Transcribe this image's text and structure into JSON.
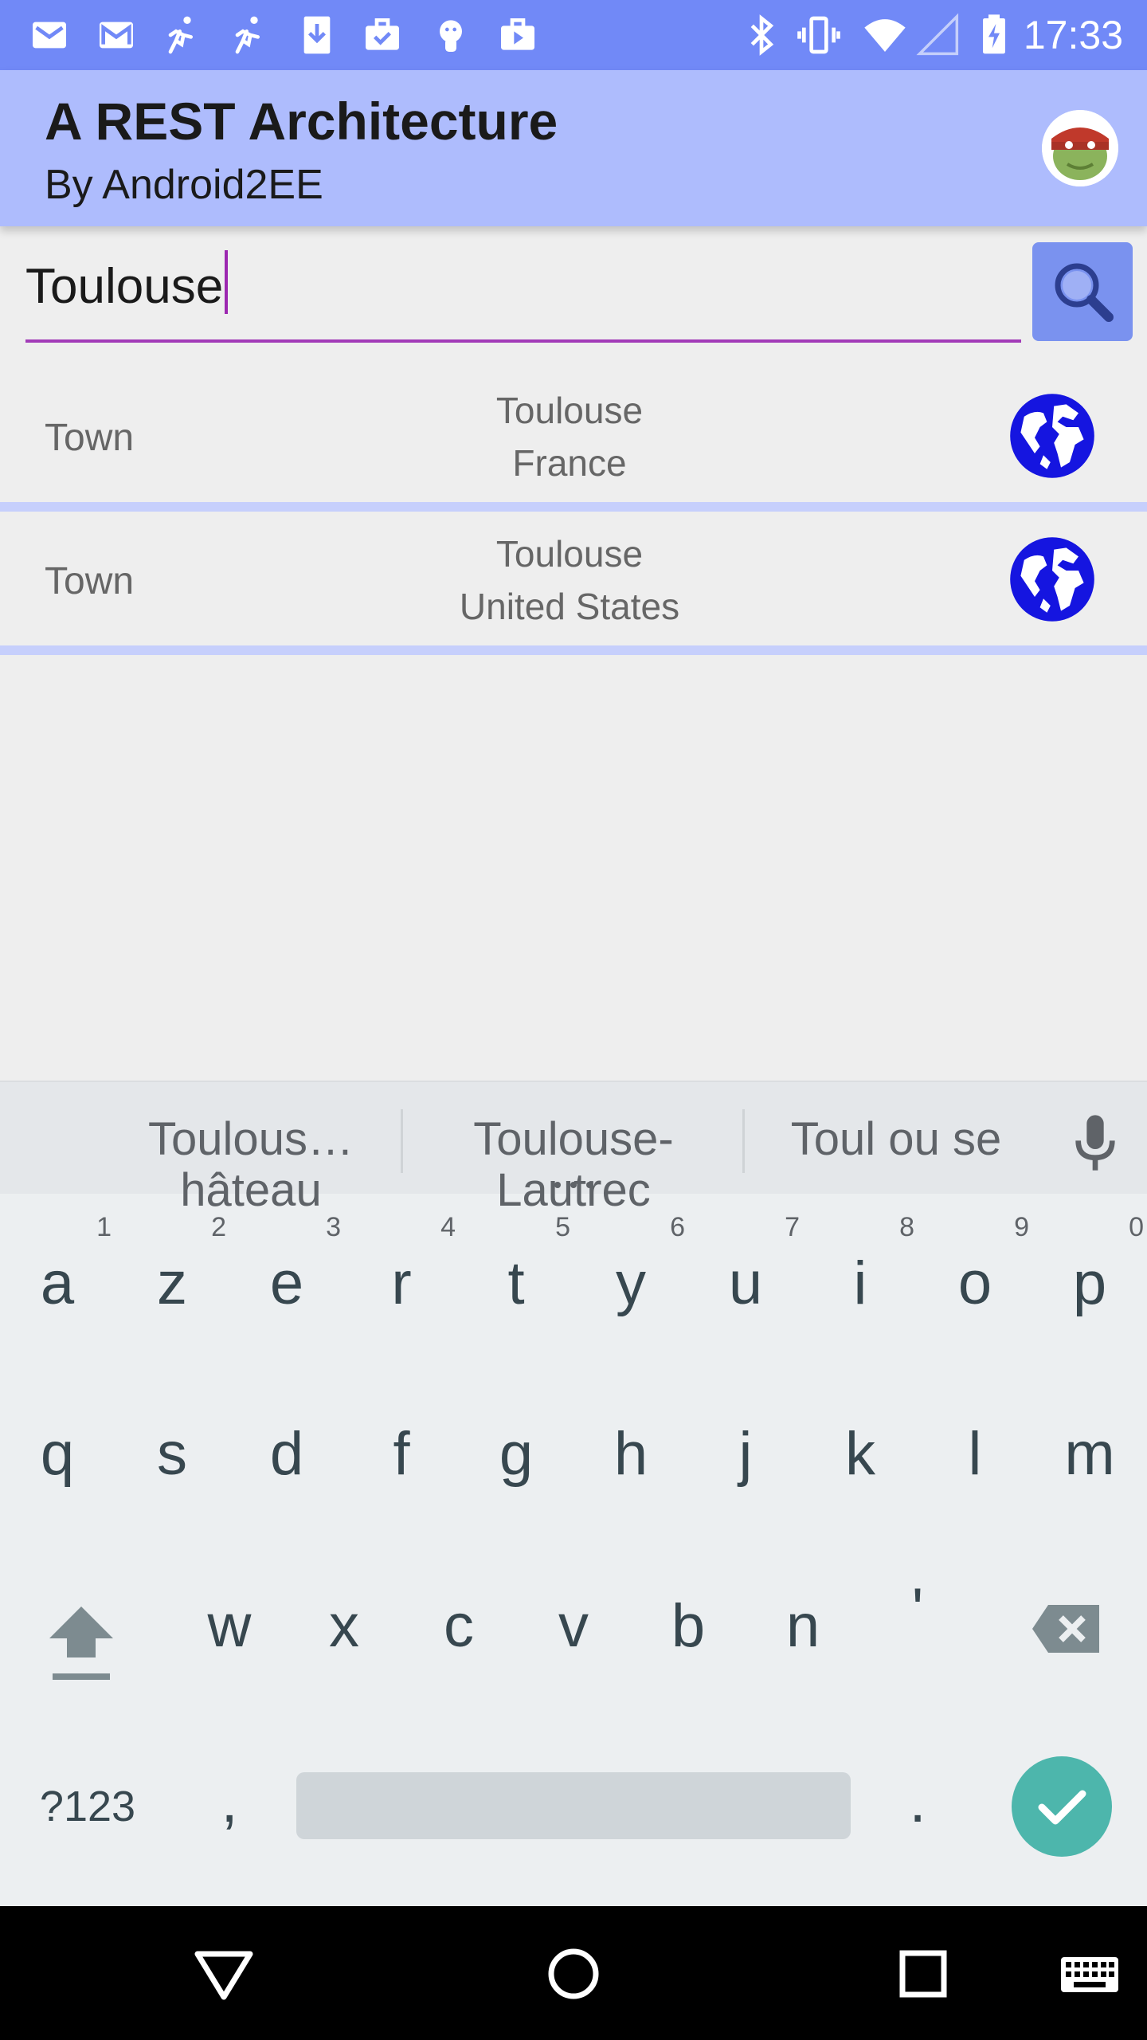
{
  "status_bar": {
    "time": "17:33",
    "notification_icons": [
      "mail-icon",
      "gmail-icon",
      "runner-icon",
      "runner-icon",
      "download-icon",
      "briefcase-check-icon",
      "android-icon",
      "briefcase-play-icon"
    ],
    "system_icons": [
      "bluetooth-icon",
      "vibrate-icon",
      "wifi-icon",
      "cell-signal-icon",
      "battery-charging-icon"
    ]
  },
  "app_bar": {
    "title": "A REST Architecture",
    "subtitle": "By Android2EE",
    "avatar_icon": "android-avatar-icon",
    "background": "#aebcfd"
  },
  "search": {
    "value": "Toulouse",
    "button_icon": "search-icon",
    "accent": "#9c27b0"
  },
  "results": [
    {
      "kind": "Town",
      "city": "Toulouse",
      "country": "France",
      "icon": "globe-icon"
    },
    {
      "kind": "Town",
      "city": "Toulouse",
      "country": "United States",
      "icon": "globe-icon"
    }
  ],
  "keyboard": {
    "suggestions": [
      "Toulous…hâteau",
      "Toulouse-Lautrec",
      "Toul ou se"
    ],
    "row1": [
      "a",
      "z",
      "e",
      "r",
      "t",
      "y",
      "u",
      "i",
      "o",
      "p"
    ],
    "row1_hints": [
      "1",
      "2",
      "3",
      "4",
      "5",
      "6",
      "7",
      "8",
      "9",
      "0"
    ],
    "row2": [
      "q",
      "s",
      "d",
      "f",
      "g",
      "h",
      "j",
      "k",
      "l",
      "m"
    ],
    "row3": [
      "w",
      "x",
      "c",
      "v",
      "b",
      "n",
      "'"
    ],
    "symbols_label": "?123",
    "comma": ",",
    "period": ".",
    "enter_color": "#4db6ac"
  },
  "nav_bar": {
    "buttons": [
      "back-icon",
      "home-icon",
      "recents-icon",
      "keyboard-icon"
    ]
  }
}
